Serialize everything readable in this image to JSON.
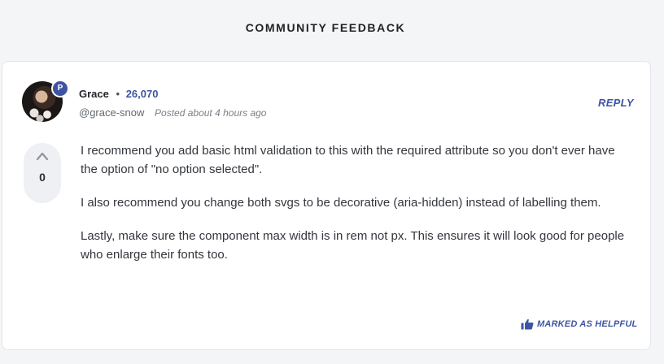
{
  "section": {
    "title": "COMMUNITY FEEDBACK"
  },
  "comment": {
    "badge": "P",
    "author": "Grace",
    "separator": "•",
    "reputation": "26,070",
    "handle": "@grace-snow",
    "posted": "Posted about 4 hours ago",
    "reply_label": "REPLY",
    "votes": "0",
    "paragraphs": [
      "I recommend you add basic html validation to this with the required attribute so you don't ever have the option of \"no option selected\".",
      "I also recommend you change both svgs to be decorative (aria-hidden) instead of labelling them.",
      "Lastly, make sure the component max width is in rem not px. This ensures it will look good for people who enlarge their fonts too."
    ],
    "helpful_label": "MARKED AS HELPFUL"
  },
  "icons": {
    "upvote": "chevron-up-icon",
    "helpful": "thumbs-up-icon"
  },
  "colors": {
    "accent": "#3e54a3",
    "background": "#f4f5f7",
    "card": "#ffffff",
    "vote_bg": "#eef0f3"
  }
}
